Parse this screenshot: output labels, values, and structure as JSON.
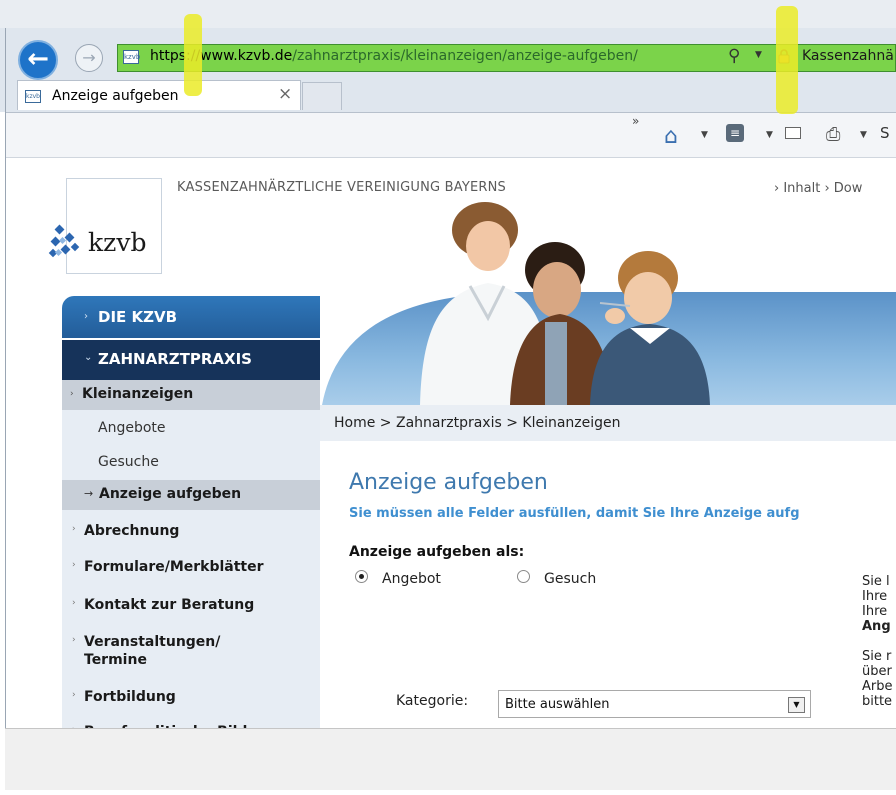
{
  "browser": {
    "url_scheme_host": "https://www.kzvb.de",
    "url_path": "/zahnarztpraxis/kleinanzeigen/anzeige-aufgeben/",
    "site_identity": "Kassenzahnä",
    "tab_title": "Anzeige aufgeben",
    "tab_close": "×",
    "cmd_overflow": "»",
    "cmd_partial": "S"
  },
  "header": {
    "org_name": "KASSENZAHNÄRZTLICHE VEREINIGUNG BAYERNS",
    "logo_text": "kzvb",
    "top_links": "› Inhalt  › Dow"
  },
  "sidebar": {
    "section1": "DIE KZVB",
    "section2": "ZAHNARZTPRAXIS",
    "active_group": "Kleinanzeigen",
    "sub_items": [
      "Angebote",
      "Gesuche"
    ],
    "active_sub": "Anzeige aufgeben",
    "items": [
      "Abrechnung",
      "Formulare/Merkblätter",
      "Kontakt zur Beratung",
      "Veranstaltungen/",
      "Termine",
      "Fortbildung",
      "Berufspolitische Bildung"
    ]
  },
  "main": {
    "breadcrumb": "Home > Zahnarztpraxis > Kleinanzeigen",
    "title": "Anzeige aufgeben",
    "subtitle": "Sie müssen alle Felder ausfüllen, damit Sie Ihre Anzeige aufg",
    "type_label": "Anzeige aufgeben als:",
    "radio_angebot": "Angebot",
    "radio_gesuch": "Gesuch",
    "selected_type": "Angebot",
    "kategorie_label": "Kategorie:",
    "kategorie_value": "Bitte auswählen",
    "side_text": [
      "Sie l",
      "Ihre",
      "Ihre",
      "Ang",
      "",
      "Sie r",
      "über",
      "Arbe",
      "bitte"
    ]
  },
  "colors": {
    "address_bar_green": "#7bd34a",
    "nav_blue": "#2f77ba",
    "nav_dark": "#16335a",
    "title_blue": "#3f79ae",
    "highlighter": "#ebeb28"
  }
}
